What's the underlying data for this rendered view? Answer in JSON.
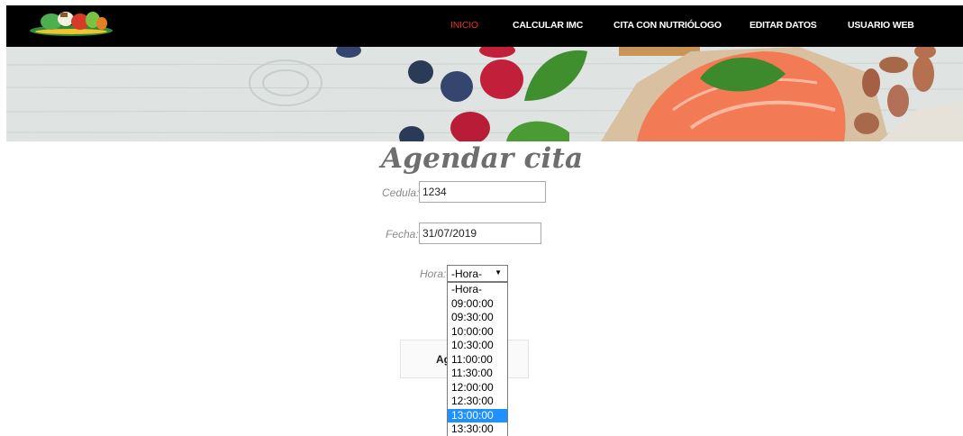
{
  "navbar": {
    "items": [
      {
        "label": "INICIO",
        "active": true
      },
      {
        "label": "CALCULAR IMC"
      },
      {
        "label": "CITA CON NUTRIÓLOGO"
      },
      {
        "label": "EDITAR DATOS"
      },
      {
        "label": "USUARIO WEB"
      }
    ]
  },
  "form": {
    "title": "Agendar cita",
    "cedula_label": "Cedula:",
    "cedula_value": "1234",
    "fecha_label": "Fecha:",
    "fecha_value": "31/07/2019",
    "hora_label": "Hora:",
    "hora_selected": "-Hora-",
    "submit_label_visible": "Ag"
  },
  "hora_options": [
    "-Hora-",
    "09:00:00",
    "09:30:00",
    "10:00:00",
    "10:30:00",
    "11:00:00",
    "11:30:00",
    "12:00:00",
    "12:30:00",
    "13:00:00",
    "13:30:00"
  ],
  "hora_highlighted": "13:00:00",
  "colors": {
    "navbar_bg": "#000000",
    "active_nav": "#e8312a",
    "title": "#6e6e6e",
    "highlight": "#1e90ff"
  }
}
